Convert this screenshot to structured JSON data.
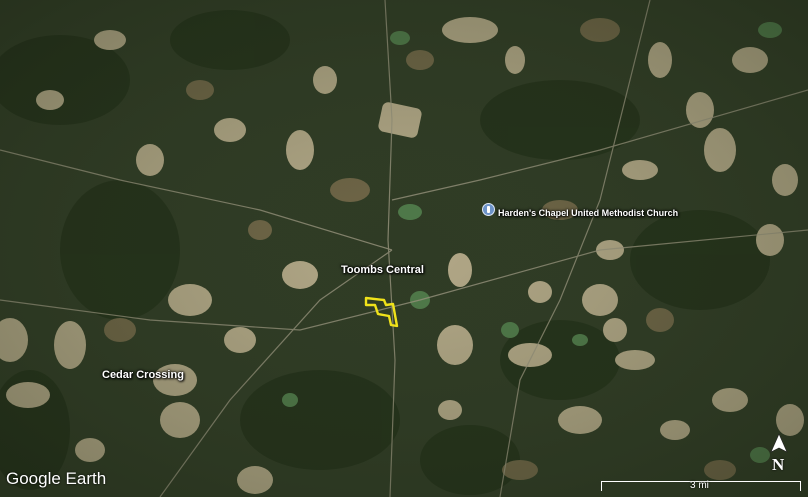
{
  "map": {
    "labels": {
      "toombs_central": "Toombs Central",
      "cedar_crossing": "Cedar Crossing",
      "hardens_chapel": "Harden's Chapel United Methodist Church"
    },
    "attribution": "Google Earth",
    "north_label": "N",
    "scale_label": "3 mi",
    "parcel_outline_color": "#f0e21a",
    "poi_icon": "church-pin-icon"
  }
}
